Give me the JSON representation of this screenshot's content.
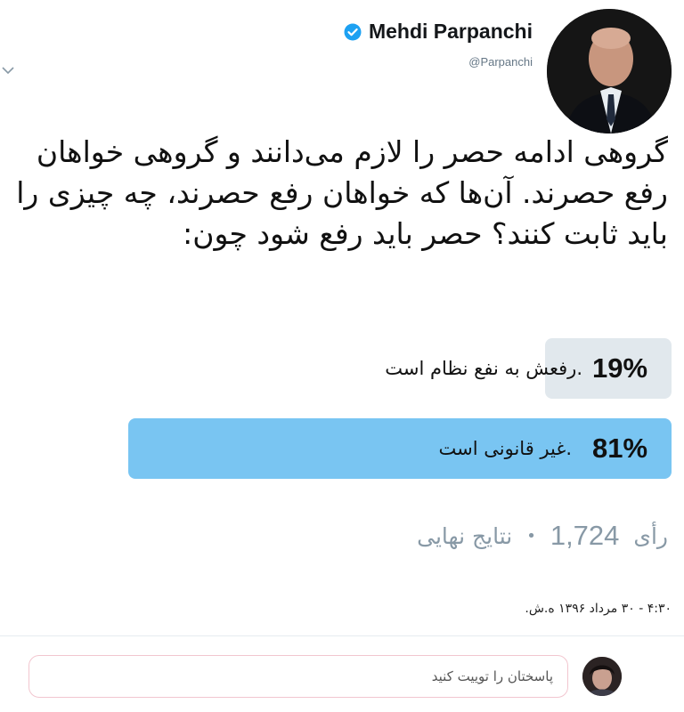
{
  "author": {
    "display_name": "Mehdi Parpanchi",
    "handle": "@Parpanchi",
    "verified_icon": "verified-badge-icon"
  },
  "tweet": {
    "text": "گروهی ادامه حصر را لازم می‌دانند و گروهی خواهان رفع حصرند. آن‌ها که خواهان رفع حصرند، چه چیزی را باید ثابت کنند؟ حصر باید رفع شود چون:"
  },
  "poll": {
    "options": [
      {
        "label": ".رفعش به نفع نظام است",
        "percent_label": "19%",
        "percent": 19
      },
      {
        "label": ".غیر قانونی است",
        "percent_label": "81%",
        "percent": 81
      }
    ],
    "votes": "1,724",
    "votes_word": "رأی",
    "status": "نتایج نهایی",
    "separator": "•"
  },
  "timestamp": "۴:۳۰ - ۳۰ مرداد ۱۳۹۶ ه.ش.",
  "reply": {
    "placeholder": "پاسختان را توییت کنید"
  },
  "colors": {
    "winner_bar": "#79c5f2",
    "loser_bar": "#e1e8ed",
    "verified": "#1da1f2"
  }
}
